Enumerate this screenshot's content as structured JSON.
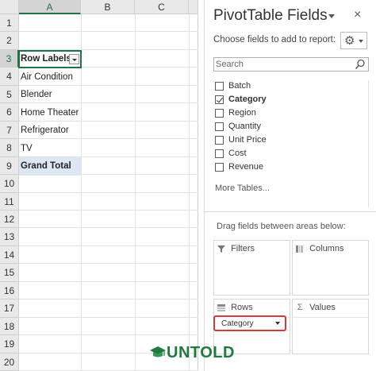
{
  "sheet": {
    "columns": [
      "A",
      "B",
      "C"
    ],
    "rows": [
      "1",
      "2",
      "3",
      "4",
      "5",
      "6",
      "7",
      "8",
      "9",
      "10",
      "11",
      "12",
      "13",
      "14",
      "15",
      "16",
      "17",
      "18",
      "19",
      "20"
    ],
    "cells": {
      "a3": "Row Labels",
      "a4": "Air Condition",
      "a5": "Blender",
      "a6": "Home Theater",
      "a7": "Refrigerator",
      "a8": "TV",
      "a9": "Grand Total"
    },
    "colors": {
      "accent": "#217346",
      "grand_total_bg": "#dde7f4"
    }
  },
  "pane": {
    "title": "PivotTable Fields",
    "close_glyph": "×",
    "choose_text": "Choose fields to add to report:",
    "gear_icon": "gear-icon",
    "search": {
      "placeholder": "Search",
      "value": ""
    },
    "fields": [
      {
        "label": "Batch",
        "checked": false
      },
      {
        "label": "Category",
        "checked": true
      },
      {
        "label": "Region",
        "checked": false
      },
      {
        "label": "Quantity",
        "checked": false
      },
      {
        "label": "Unit Price",
        "checked": false
      },
      {
        "label": "Cost",
        "checked": false
      },
      {
        "label": "Revenue",
        "checked": false
      }
    ],
    "more_tables": "More Tables...",
    "drag_text": "Drag fields between areas below:",
    "areas": {
      "filters": "Filters",
      "columns": "Columns",
      "rows": "Rows",
      "values": "Values"
    },
    "rows_field": "Category",
    "highlight_color": "#d93a3a"
  },
  "watermark": {
    "text": "UNTOLD",
    "logo_icon": "graduation-cap-icon"
  }
}
